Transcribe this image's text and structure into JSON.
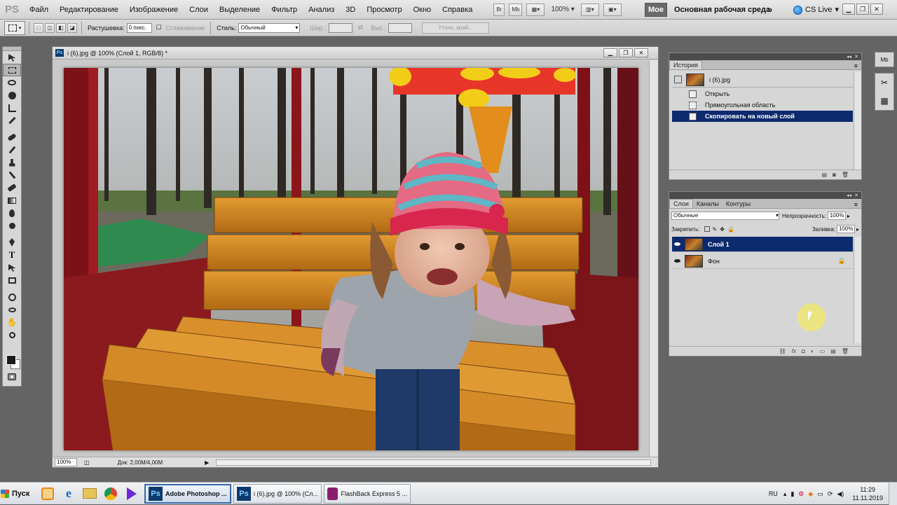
{
  "menu": {
    "logo": "PS",
    "items": [
      "Файл",
      "Редактирование",
      "Изображение",
      "Слои",
      "Выделение",
      "Фильтр",
      "Анализ",
      "3D",
      "Просмотр",
      "Окно",
      "Справка"
    ],
    "mini_br": "Br",
    "mini_mb": "Mb",
    "zoom": "100%",
    "workspace_moe": "Мое",
    "workspace_main": "Основная рабочая среда",
    "cs_live": "CS Live"
  },
  "options": {
    "feather_label": "Растушевка:",
    "feather_value": "0 пикс.",
    "antialias_label": "Сглаживание",
    "style_label": "Стиль:",
    "style_value": "Обычный",
    "width_label": "Шир.:",
    "height_label": "Выс.:",
    "refine_label": "Уточн. край..."
  },
  "document": {
    "title": "i (6).jpg @ 100% (Слой 1, RGB/8) *",
    "zoom": "100%",
    "doc_size": "Док: 2,00M/4,00M"
  },
  "history": {
    "tab": "История",
    "snapshot": "i (6).jpg",
    "steps": [
      "Открыть",
      "Прямоугольная область",
      "Скопировать на новый слой"
    ]
  },
  "layers": {
    "tabs": [
      "Слои",
      "Каналы",
      "Контуры"
    ],
    "blend_mode": "Обычные",
    "opacity_label": "Непрозрачность:",
    "opacity_value": "100%",
    "lock_label": "Закрепить:",
    "fill_label": "Заливка:",
    "fill_value": "100%",
    "items": [
      "Слой 1",
      "Фон"
    ]
  },
  "taskbar": {
    "start": "Пуск",
    "windows": [
      "Adobe Photoshop ...",
      "i (6).jpg @ 100% (Сл...",
      "FlashBack Express 5 ..."
    ],
    "lang": "RU",
    "time": "11:29",
    "date": "11.11.2019"
  },
  "colors": {
    "selection": "#0d2a6e",
    "accent": "#3a66a8"
  }
}
